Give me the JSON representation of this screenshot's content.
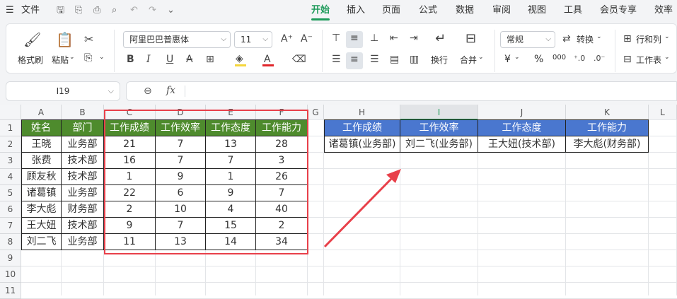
{
  "menu": {
    "file": "文件",
    "tabs": [
      "开始",
      "插入",
      "页面",
      "公式",
      "数据",
      "审阅",
      "视图",
      "工具",
      "会员专享",
      "效率"
    ],
    "active_tab": "开始"
  },
  "ribbon": {
    "format_painter": "格式刷",
    "paste": "粘贴",
    "font_name": "阿里巴巴普惠体",
    "font_size": "11",
    "number_format": "常规",
    "convert": "转换",
    "wrap": "换行",
    "merge": "合并",
    "rows_cols": "行和列",
    "worksheet": "工作表",
    "currency_symbol": "¥",
    "percent_symbol": "%",
    "thousands_symbol": "000"
  },
  "formula_bar": {
    "cell_ref": "I19",
    "fx": "fx",
    "content": ""
  },
  "sheet": {
    "columns": [
      "A",
      "B",
      "C",
      "D",
      "E",
      "F",
      "G",
      "H",
      "I",
      "J",
      "K",
      "L"
    ],
    "selected_column": "I",
    "rows": [
      "1",
      "2",
      "3",
      "4",
      "5",
      "6",
      "7",
      "8",
      "9",
      "10",
      "11"
    ],
    "left_headers": [
      "姓名",
      "部门",
      "工作成绩",
      "工作效率",
      "工作态度",
      "工作能力"
    ],
    "left_data": [
      [
        "王晓",
        "业务部",
        "21",
        "7",
        "13",
        "28"
      ],
      [
        "张费",
        "技术部",
        "16",
        "7",
        "7",
        "3"
      ],
      [
        "顾友秋",
        "技术部",
        "1",
        "9",
        "1",
        "26"
      ],
      [
        "诸葛镇",
        "业务部",
        "22",
        "6",
        "9",
        "7"
      ],
      [
        "李大彪",
        "财务部",
        "2",
        "10",
        "4",
        "40"
      ],
      [
        "王大妞",
        "技术部",
        "9",
        "7",
        "15",
        "2"
      ],
      [
        "刘二飞",
        "业务部",
        "11",
        "13",
        "14",
        "34"
      ]
    ],
    "right_headers": [
      "工作成绩",
      "工作效率",
      "工作态度",
      "工作能力"
    ],
    "right_data": [
      "诸葛镇(业务部)",
      "刘二飞(业务部)",
      "王大妞(技术部)",
      "李大彪(财务部)"
    ]
  },
  "colors": {
    "active_tab": "#1f9b5b",
    "left_header_fill": "#4e8b2d",
    "right_header_fill": "#4a77cf",
    "highlight_box": "#e8404a",
    "arrow": "#e8404a"
  }
}
